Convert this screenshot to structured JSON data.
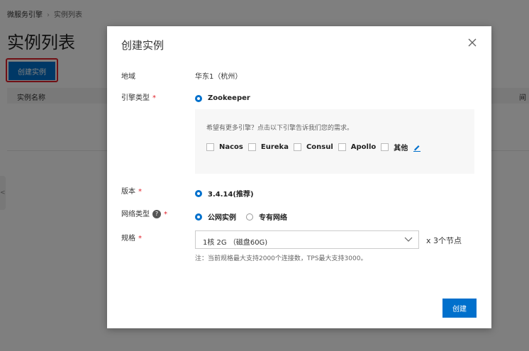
{
  "background": {
    "breadcrumb": [
      "微服务引擎",
      "实例列表"
    ],
    "page_title": "实例列表",
    "create_button": "创建实例",
    "table": {
      "col_name": "实例名称",
      "col_right": "间"
    },
    "side_tab": "<"
  },
  "modal": {
    "title": "创建实例",
    "close_icon": "close-icon",
    "region": {
      "label": "地域",
      "value": "华东1（杭州）"
    },
    "engine": {
      "label": "引擎类型",
      "required": "*",
      "option": "Zookeeper",
      "tip": "希望有更多引擎？点击以下引擎告诉我们您的需求。",
      "choices": [
        "Nacos",
        "Eureka",
        "Consul",
        "Apollo",
        "其他"
      ],
      "edit_icon": "pencil-icon"
    },
    "version": {
      "label": "版本",
      "required": "*",
      "option": "3.4.14(推荐)"
    },
    "network": {
      "label": "网络类型",
      "help": "?",
      "required": "*",
      "options": [
        "公网实例",
        "专有网络"
      ]
    },
    "spec": {
      "label": "规格",
      "required": "*",
      "selected": "1核 2G （磁盘60G)",
      "nodes": "x 3个节点",
      "note": "注：当前规格最大支持2000个连接数，TPS最大支持3000。"
    },
    "submit": "创建"
  },
  "colors": {
    "accent": "#0070cc",
    "required": "#e0212a",
    "highlight": "#e0212a"
  }
}
